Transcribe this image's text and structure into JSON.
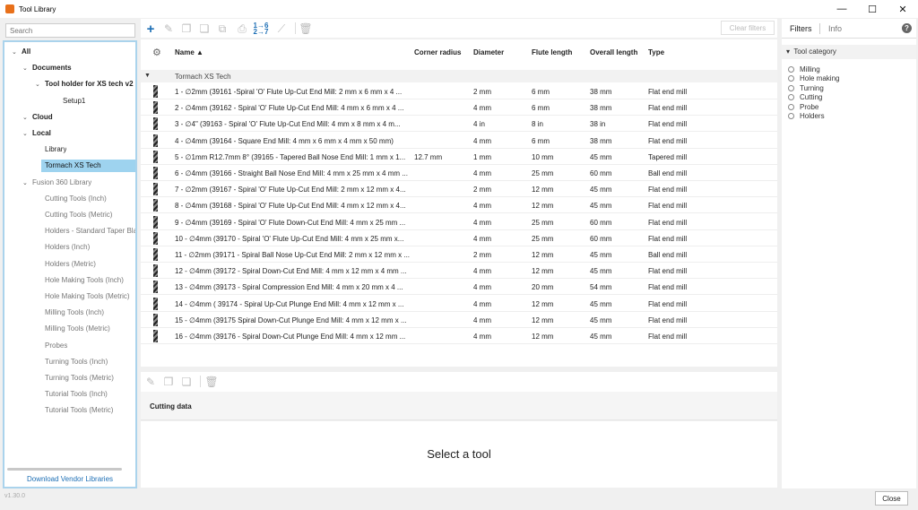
{
  "window": {
    "title": "Tool Library",
    "minimize": "—",
    "maximize": "☐",
    "close": "✕"
  },
  "sidebar": {
    "search_placeholder": "Search",
    "tree": [
      {
        "label": "All",
        "level": 0,
        "expanded": true,
        "bold": true
      },
      {
        "label": "Documents",
        "level": 1,
        "expanded": true,
        "bold": true
      },
      {
        "label": "Tool holder for XS tech v2",
        "level": 2,
        "expanded": true,
        "bold": true
      },
      {
        "label": "Setup1",
        "level": 3,
        "bold": false
      },
      {
        "label": "Cloud",
        "level": 1,
        "expanded": true,
        "bold": true
      },
      {
        "label": "Local",
        "level": 1,
        "expanded": true,
        "bold": true
      },
      {
        "label": "Library",
        "level": 2,
        "bold": false
      },
      {
        "label": "Tormach XS Tech",
        "level": 2,
        "bold": false,
        "selected": true
      },
      {
        "label": "Fusion 360 Library",
        "level": 1,
        "expanded": true,
        "bold": false,
        "gray": true
      },
      {
        "label": "Cutting Tools (Inch)",
        "level": 2,
        "gray": true
      },
      {
        "label": "Cutting Tools (Metric)",
        "level": 2,
        "gray": true
      },
      {
        "label": "Holders - Standard Taper Bla",
        "level": 2,
        "gray": true
      },
      {
        "label": "Holders (Inch)",
        "level": 2,
        "gray": true
      },
      {
        "label": "Holders (Metric)",
        "level": 2,
        "gray": true
      },
      {
        "label": "Hole Making Tools (Inch)",
        "level": 2,
        "gray": true
      },
      {
        "label": "Hole Making Tools (Metric)",
        "level": 2,
        "gray": true
      },
      {
        "label": "Milling Tools (Inch)",
        "level": 2,
        "gray": true
      },
      {
        "label": "Milling Tools (Metric)",
        "level": 2,
        "gray": true
      },
      {
        "label": "Probes",
        "level": 2,
        "gray": true
      },
      {
        "label": "Turning Tools (Inch)",
        "level": 2,
        "gray": true
      },
      {
        "label": "Turning Tools (Metric)",
        "level": 2,
        "gray": true
      },
      {
        "label": "Tutorial Tools (Inch)",
        "level": 2,
        "gray": true
      },
      {
        "label": "Tutorial Tools (Metric)",
        "level": 2,
        "gray": true
      }
    ],
    "vendor_link": "Download Vendor Libraries",
    "version": "v1.30.0"
  },
  "toolbar": {
    "clear_filters": "Clear filters"
  },
  "table": {
    "headers": {
      "name": "Name",
      "corner_radius": "Corner radius",
      "diameter": "Diameter",
      "flute_length": "Flute length",
      "overall_length": "Overall length",
      "type": "Type"
    },
    "group": "Tormach XS Tech",
    "rows": [
      {
        "name": "1 - ∅2mm (39161 -Spiral 'O' Flute Up-Cut End Mill: 2 mm x 6 mm x 4 ...",
        "corner": "",
        "diameter": "2 mm",
        "flute": "6 mm",
        "overall": "38 mm",
        "type": "Flat end mill"
      },
      {
        "name": "2 - ∅4mm (39162 - Spiral 'O' Flute Up-Cut End Mill: 4 mm x 6 mm x 4 ...",
        "corner": "",
        "diameter": "4 mm",
        "flute": "6 mm",
        "overall": "38 mm",
        "type": "Flat end mill"
      },
      {
        "name": "3 - ∅4\" (39163 - Spiral 'O' Flute Up-Cut End Mill: 4 mm x 8 mm x 4 m...",
        "corner": "",
        "diameter": "4 in",
        "flute": "8 in",
        "overall": "38 in",
        "type": "Flat end mill"
      },
      {
        "name": "4 - ∅4mm (39164 - Square End Mill: 4 mm x 6 mm x 4 mm x 50 mm)",
        "corner": "",
        "diameter": "4 mm",
        "flute": "6 mm",
        "overall": "38 mm",
        "type": "Flat end mill"
      },
      {
        "name": "5 - ∅1mm R12.7mm 8° (39165 - Tapered Ball Nose End Mill: 1 mm x 1...",
        "corner": "12.7 mm",
        "diameter": "1 mm",
        "flute": "10 mm",
        "overall": "45 mm",
        "type": "Tapered mill"
      },
      {
        "name": "6 - ∅4mm (39166 - Straight Ball Nose End Mill: 4 mm x 25 mm x 4 mm ...",
        "corner": "",
        "diameter": "4 mm",
        "flute": "25 mm",
        "overall": "60 mm",
        "type": "Ball end mill"
      },
      {
        "name": "7 - ∅2mm (39167 - Spiral 'O' Flute Up-Cut End Mill: 2 mm x 12 mm x 4...",
        "corner": "",
        "diameter": "2 mm",
        "flute": "12 mm",
        "overall": "45 mm",
        "type": "Flat end mill"
      },
      {
        "name": "8 - ∅4mm (39168 - Spiral 'O' Flute Up-Cut End Mill: 4 mm x 12 mm x 4...",
        "corner": "",
        "diameter": "4 mm",
        "flute": "12 mm",
        "overall": "45 mm",
        "type": "Flat end mill"
      },
      {
        "name": "9 - ∅4mm (39169 - Spiral 'O' Flute Down-Cut End Mill: 4 mm x 25 mm ...",
        "corner": "",
        "diameter": "4 mm",
        "flute": "25 mm",
        "overall": "60 mm",
        "type": "Flat end mill"
      },
      {
        "name": "10 - ∅4mm (39170 - Spiral 'O' Flute Up-Cut End Mill: 4 mm x 25 mm x...",
        "corner": "",
        "diameter": "4 mm",
        "flute": "25 mm",
        "overall": "60 mm",
        "type": "Flat end mill"
      },
      {
        "name": "11 - ∅2mm (39171 - Spiral Ball Nose Up-Cut End Mill: 2 mm x 12 mm x ...",
        "corner": "",
        "diameter": "2 mm",
        "flute": "12 mm",
        "overall": "45 mm",
        "type": "Ball end mill"
      },
      {
        "name": "12 - ∅4mm (39172 - Spiral Down-Cut End Mill: 4 mm x 12 mm x 4 mm ...",
        "corner": "",
        "diameter": "4 mm",
        "flute": "12 mm",
        "overall": "45 mm",
        "type": "Flat end mill"
      },
      {
        "name": "13 - ∅4mm (39173 - Spiral Compression End Mill: 4 mm x 20 mm x 4 ...",
        "corner": "",
        "diameter": "4 mm",
        "flute": "20 mm",
        "overall": "54 mm",
        "type": "Flat end mill"
      },
      {
        "name": "14 - ∅4mm ( 39174 - Spiral Up-Cut Plunge End Mill: 4 mm x 12 mm x ...",
        "corner": "",
        "diameter": "4 mm",
        "flute": "12 mm",
        "overall": "45 mm",
        "type": "Flat end mill"
      },
      {
        "name": "15 - ∅4mm (39175 Spiral Down-Cut Plunge End Mill: 4 mm x 12 mm x ...",
        "corner": "",
        "diameter": "4 mm",
        "flute": "12 mm",
        "overall": "45 mm",
        "type": "Flat end mill"
      },
      {
        "name": "16 - ∅4mm (39176 - Spiral Down-Cut Plunge End Mill: 4 mm x 12 mm ...",
        "corner": "",
        "diameter": "4 mm",
        "flute": "12 mm",
        "overall": "45 mm",
        "type": "Flat end mill"
      }
    ]
  },
  "cutting": {
    "label": "Cutting data",
    "empty_message": "Select a tool"
  },
  "filters": {
    "tab_filters": "Filters",
    "tab_info": "Info",
    "help": "?",
    "category_label": "Tool category",
    "options": [
      "Milling",
      "Hole making",
      "Turning",
      "Cutting",
      "Probe",
      "Holders"
    ]
  },
  "footer": {
    "close": "Close"
  },
  "colors": {
    "accent": "#1d6fb5",
    "selected": "#9ed3ef",
    "panel_border": "#aad3ec"
  }
}
